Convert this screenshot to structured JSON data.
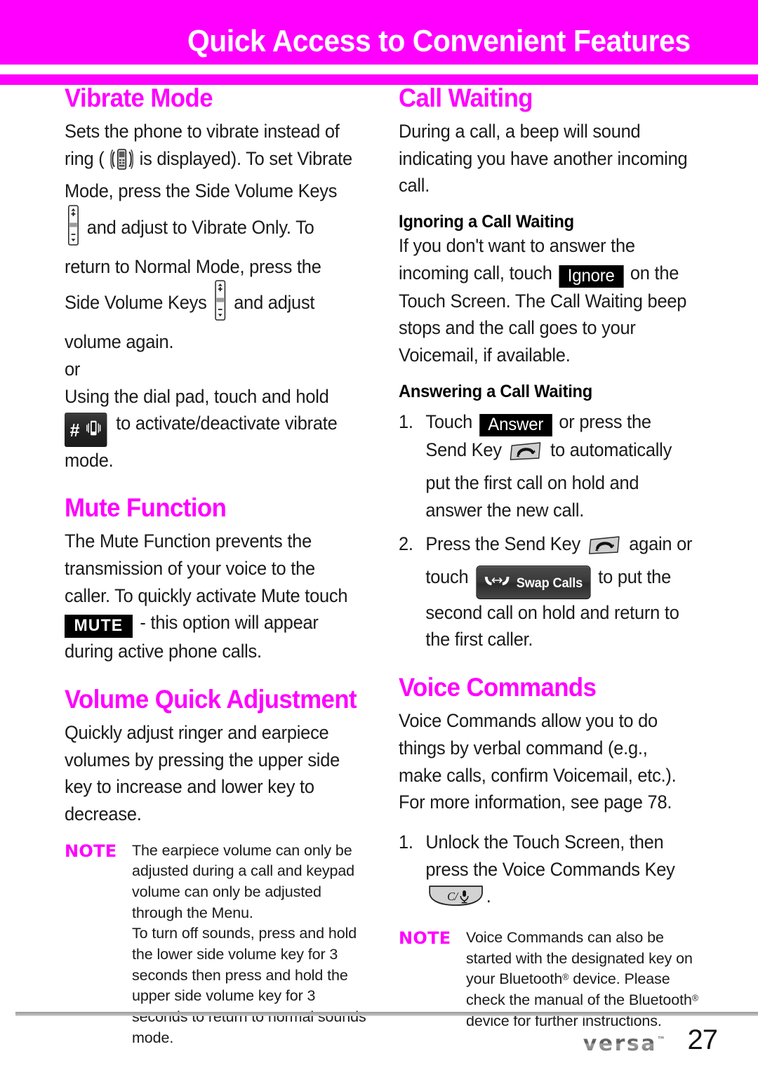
{
  "header": {
    "title": "Quick Access to Convenient Features",
    "band_color": "#ff00ff",
    "title_color": "#ffffff"
  },
  "colors": {
    "accent": "#ff00ff",
    "body_text": "#1a1a1a",
    "badge_bg": "#000000",
    "badge_text": "#ffffff"
  },
  "left_column": {
    "sections": [
      {
        "title": "Vibrate Mode",
        "paragraphs": [
          {
            "parts": [
              {
                "type": "text",
                "value": "Sets the phone to vibrate instead of ring ( "
              },
              {
                "type": "icon",
                "name": "vibrating-phone-icon"
              },
              {
                "type": "text",
                "value": " is displayed). To set Vibrate Mode, press the Side Volume Keys "
              },
              {
                "type": "icon",
                "name": "side-volume-rocker-key-icon"
              },
              {
                "type": "text",
                "value": " and adjust to Vibrate Only. To return to Normal Mode, press the Side Volume Keys "
              },
              {
                "type": "icon",
                "name": "side-volume-rocker-key-icon"
              },
              {
                "type": "text",
                "value": " and adjust volume again."
              }
            ]
          },
          {
            "parts": [
              {
                "type": "text",
                "value": "or"
              }
            ]
          },
          {
            "parts": [
              {
                "type": "text",
                "value": "Using the dial pad, touch and hold "
              },
              {
                "type": "chip",
                "name": "dialpad-hash-vibrate-key",
                "label": "#"
              },
              {
                "type": "text",
                "value": " to activate/deactivate vibrate mode."
              }
            ]
          }
        ]
      },
      {
        "title": "Mute Function",
        "paragraphs": [
          {
            "parts": [
              {
                "type": "text",
                "value": "The Mute Function prevents the transmission of your voice to the caller. To quickly activate Mute touch "
              },
              {
                "type": "badge",
                "name": "mute-badge",
                "label": "MUTE"
              },
              {
                "type": "text",
                "value": " - this option will appear during active phone calls."
              }
            ]
          }
        ]
      },
      {
        "title": "Volume Quick Adjustment",
        "paragraphs": [
          {
            "parts": [
              {
                "type": "text",
                "value": "Quickly adjust ringer and earpiece volumes by pressing the upper side key to increase and lower key to decrease."
              }
            ]
          }
        ],
        "note": {
          "label": "NOTE",
          "paragraphs": [
            "The earpiece volume can only be adjusted during a call and keypad volume can only be adjusted through the Menu.",
            "To turn off sounds, press and hold the lower side volume key for 3 seconds then press and hold the upper side volume key for 3 seconds to return to normal sounds mode."
          ]
        }
      }
    ]
  },
  "right_column": {
    "sections": [
      {
        "title": "Call Waiting",
        "paragraphs": [
          {
            "parts": [
              {
                "type": "text",
                "value": "During a call, a beep will sound indicating you have another incoming call."
              }
            ]
          }
        ],
        "subsections": [
          {
            "title": "Ignoring a Call Waiting",
            "paragraphs": [
              {
                "parts": [
                  {
                    "type": "text",
                    "value": "If you don't want to answer the incoming call, touch "
                  },
                  {
                    "type": "badge",
                    "name": "ignore-badge",
                    "label": "Ignore"
                  },
                  {
                    "type": "text",
                    "value": " on the Touch Screen. The Call Waiting beep stops and the call goes to your Voicemail, if available."
                  }
                ]
              }
            ]
          },
          {
            "title": "Answering a Call Waiting",
            "list": [
              {
                "marker": "1.",
                "parts": [
                  {
                    "type": "text",
                    "value": "Touch "
                  },
                  {
                    "type": "badge",
                    "name": "answer-badge",
                    "label": "Answer"
                  },
                  {
                    "type": "text",
                    "value": " or press the Send Key "
                  },
                  {
                    "type": "icon",
                    "name": "send-key-icon"
                  },
                  {
                    "type": "text",
                    "value": " to automatically put the first call on hold and answer the new call."
                  }
                ]
              },
              {
                "marker": "2.",
                "parts": [
                  {
                    "type": "text",
                    "value": "Press the Send Key "
                  },
                  {
                    "type": "icon",
                    "name": "send-key-icon"
                  },
                  {
                    "type": "text",
                    "value": " again or touch "
                  },
                  {
                    "type": "chip",
                    "name": "swap-calls-button",
                    "label": "Swap Calls"
                  },
                  {
                    "type": "text",
                    "value": " to put the second call on hold and return to the first caller."
                  }
                ]
              }
            ]
          }
        ]
      },
      {
        "title": "Voice Commands",
        "paragraphs": [
          {
            "parts": [
              {
                "type": "text",
                "value": "Voice Commands allow you to do things by verbal command (e.g., make calls, confirm Voicemail, etc.). For more information, see page 78."
              }
            ]
          }
        ],
        "list": [
          {
            "marker": "1.",
            "parts": [
              {
                "type": "text",
                "value": "Unlock the Touch Screen, then press the Voice Commands Key "
              },
              {
                "type": "icon",
                "name": "clear-voice-command-key-icon",
                "label": "C/"
              },
              {
                "type": "text",
                "value": "."
              }
            ]
          }
        ],
        "note": {
          "label": "NOTE",
          "paragraphs": [
            "Voice Commands can also be started with the designated key on your Bluetooth® device. Please check the manual of the Bluetooth® device for further instructions."
          ]
        }
      }
    ]
  },
  "footer": {
    "brand": "versa",
    "brand_tm": "™",
    "page_number": "27"
  }
}
